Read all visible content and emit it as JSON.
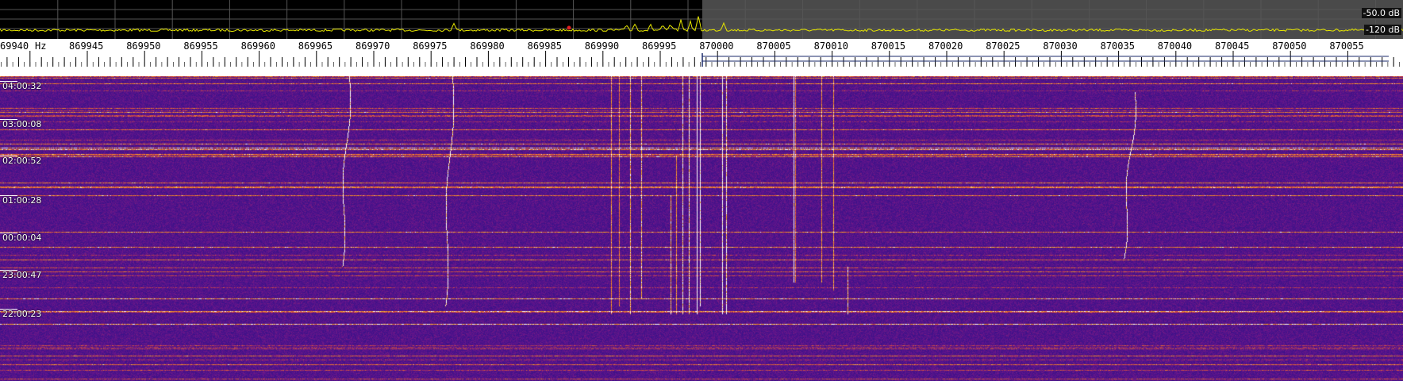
{
  "spectrum": {
    "ref_level": "-50.0 dB",
    "bottom_level": "-120 dB",
    "colors": {
      "trace": "#e6e600",
      "left_bg": "#000000",
      "right_bg": "#4a4a4a",
      "grid": "#555555"
    }
  },
  "scale": {
    "unit": "Hz",
    "first_label": "69940",
    "labels": [
      "869945",
      "869950",
      "869955",
      "869960",
      "869965",
      "869970",
      "869975",
      "869980",
      "869985",
      "869990",
      "869995",
      "870000",
      "870005",
      "870010",
      "870015",
      "870020",
      "870025",
      "870030",
      "870035",
      "870040",
      "870045",
      "870050",
      "870055"
    ]
  },
  "waterfall": {
    "times": [
      "04:00:32",
      "03:00:08",
      "02:00:52",
      "01:00:28",
      "00:00:04",
      "23:00:47",
      "22:00:23"
    ],
    "colors": {
      "background": "#3a1288",
      "signal": "#ffb020",
      "hot": "#ffffff"
    }
  }
}
